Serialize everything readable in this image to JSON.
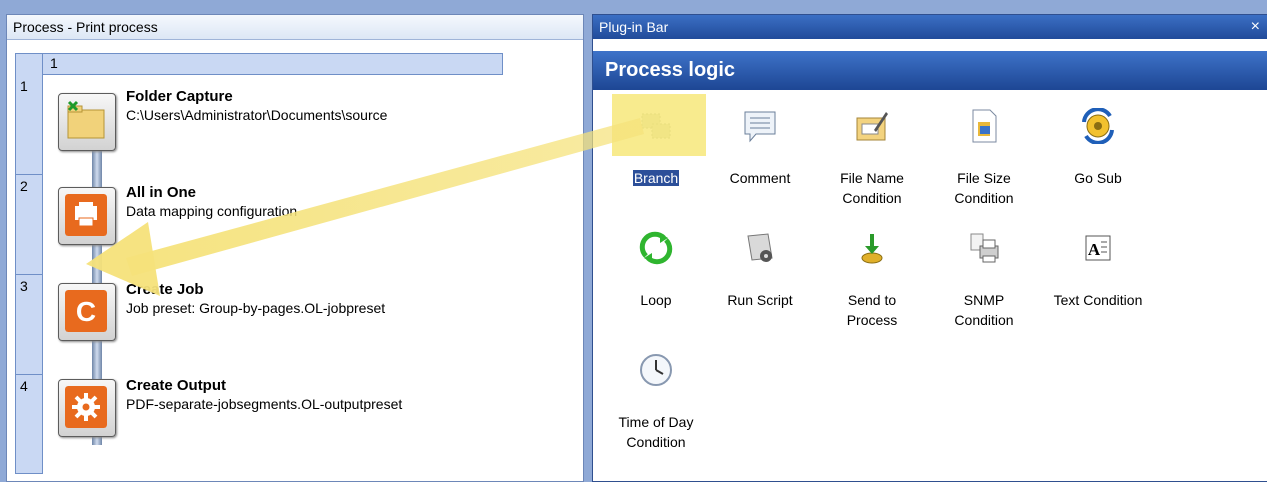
{
  "process_panel": {
    "title": "Process - Print process",
    "column_header": "1",
    "rows": [
      "1",
      "2",
      "3",
      "4"
    ],
    "tasks": [
      {
        "name": "Folder Capture",
        "desc": "C:\\Users\\Administrator\\Documents\\source",
        "icon": "folder-capture-icon"
      },
      {
        "name": "All in One",
        "desc": "Data mapping configuration",
        "icon": "all-in-one-icon"
      },
      {
        "name": "Create Job",
        "desc": "Job preset: Group-by-pages.OL-jobpreset",
        "icon": "create-job-icon"
      },
      {
        "name": "Create Output",
        "desc": "PDF-separate-jobsegments.OL-outputpreset",
        "icon": "create-output-icon"
      }
    ]
  },
  "plugin_bar": {
    "title": "Plug-in Bar",
    "close": "×",
    "header": "Process logic",
    "items": [
      {
        "label": "Branch",
        "icon": "branch-icon"
      },
      {
        "label": "Comment",
        "icon": "comment-icon"
      },
      {
        "label1": "File Name",
        "label2": "Condition",
        "icon": "file-name-condition-icon"
      },
      {
        "label1": "File Size",
        "label2": "Condition",
        "icon": "file-size-condition-icon"
      },
      {
        "label": "Go Sub",
        "icon": "go-sub-icon"
      },
      {
        "label": "Loop",
        "icon": "loop-icon"
      },
      {
        "label": "Run Script",
        "icon": "run-script-icon"
      },
      {
        "label1": "Send to",
        "label2": "Process",
        "icon": "send-to-process-icon"
      },
      {
        "label1": "SNMP",
        "label2": "Condition",
        "icon": "snmp-condition-icon"
      },
      {
        "label": "Text Condition",
        "icon": "text-condition-icon"
      },
      {
        "label1": "Time of Day",
        "label2": "Condition",
        "icon": "time-of-day-condition-icon"
      }
    ]
  },
  "colors": {
    "accent": "#214b9a",
    "highlight": "#f7e77a",
    "task_orange": "#e86a1e"
  }
}
